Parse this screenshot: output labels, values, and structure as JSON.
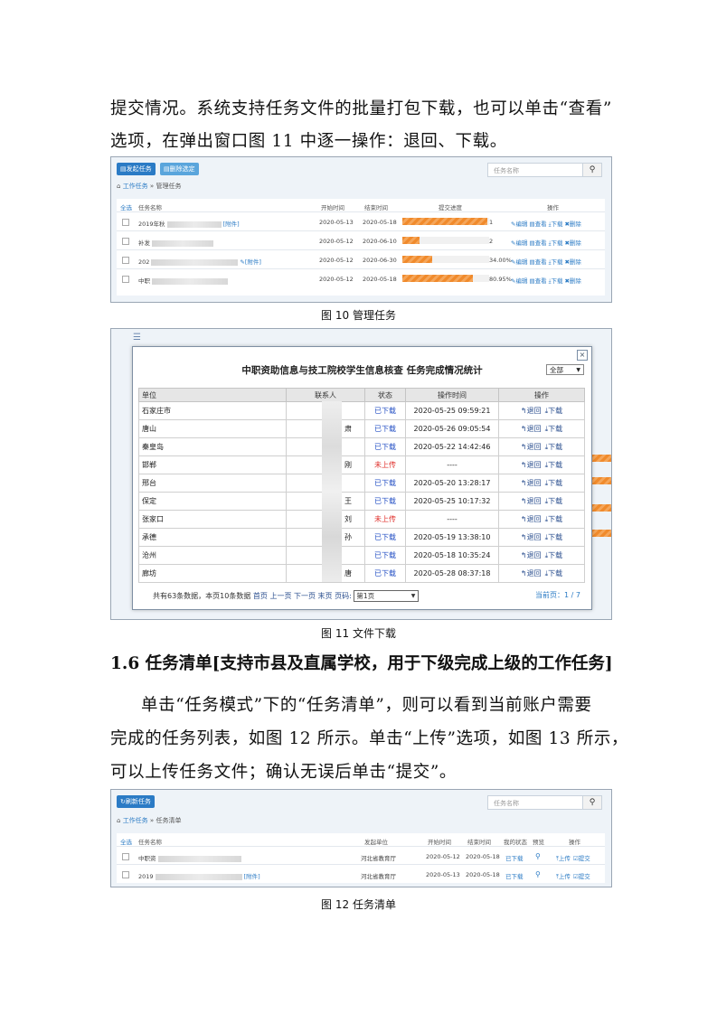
{
  "doc": {
    "para1_line1": "提交情况。系统支持任务文件的批量打包下载，也可以单击“查看”",
    "para1_line2": "选项，在弹出窗口图 11 中逐一操作：退回、下载。",
    "caption10": "图 10 管理任务",
    "caption11": "图 11 文件下载",
    "heading": "1.6 任务清单[支持市县及直属学校，用于下级完成上级的工作任务]",
    "para2_line1": "单击“任务模式”下的“任务清单”，则可以看到当前账户需要",
    "para2_line2": "完成的任务列表，如图 12 所示。单击“上传”选项，如图 13 所示，",
    "para2_line3": "可以上传任务文件；确认无误后单击“提交”。",
    "caption12": "图 12 任务清单"
  },
  "fig10": {
    "btn_new": "▤发起任务",
    "btn_delete": "▤删除选定",
    "search_placeholder": "任务名称",
    "search_icon": "search-icon",
    "crumb_home_icon": "home-icon",
    "crumb_link": "工作任务",
    "crumb_sep": "»",
    "crumb_current": "管理任务",
    "headers": {
      "select_all": "全选",
      "name": "任务名称",
      "start": "开始时间",
      "end": "结束时间",
      "progress": "提交进度",
      "ops": "操作"
    },
    "rows": [
      {
        "name": "2019年秋",
        "attach": "[附件]",
        "start": "2020-05-13",
        "end": "2020-05-18",
        "progress": 0.98,
        "pct": "1",
        "ops": [
          "✎编辑",
          "▤查看",
          "⤓下载",
          "✖删除"
        ]
      },
      {
        "name": "补发",
        "attach": "",
        "start": "2020-05-12",
        "end": "2020-06-10",
        "progress": 0.2,
        "pct": "2",
        "ops": [
          "✎编辑",
          "▤查看",
          "⤓下载",
          "✖删除"
        ]
      },
      {
        "name": "202",
        "attach": "✎[附件]",
        "start": "2020-05-12",
        "end": "2020-06-30",
        "progress": 0.34,
        "pct": "34.00%",
        "ops": [
          "✎编辑",
          "▤查看",
          "⤓下载",
          "✖删除"
        ]
      },
      {
        "name": "中职",
        "attach": "",
        "start": "2020-05-12",
        "end": "2020-05-18",
        "progress": 0.8095,
        "pct": "80.95%",
        "ops": [
          "✎编辑",
          "▤查看",
          "⤓下载",
          "✖删除"
        ]
      }
    ]
  },
  "fig11": {
    "menu_icon": "menu-icon",
    "title": "中职资助信息与技工院校学生信息核查 任务完成情况统计",
    "filter": "全部",
    "close": "×",
    "headers": {
      "unit": "单位",
      "contact": "联系人",
      "status": "状态",
      "time": "操作时间",
      "ops": "操作"
    },
    "rows": [
      {
        "unit": "石家庄市",
        "contact": "",
        "status": "已下载",
        "ok": true,
        "time": "2020-05-25 09:59:21"
      },
      {
        "unit": "唐山",
        "contact": "肃",
        "status": "已下载",
        "ok": true,
        "time": "2020-05-26 09:05:54"
      },
      {
        "unit": "秦皇岛",
        "contact": "",
        "status": "已下载",
        "ok": true,
        "time": "2020-05-22 14:42:46"
      },
      {
        "unit": "邯郸",
        "contact": "刚",
        "status": "未上传",
        "ok": false,
        "time": "----"
      },
      {
        "unit": "邢台",
        "contact": "",
        "status": "已下载",
        "ok": true,
        "time": "2020-05-20 13:28:17"
      },
      {
        "unit": "保定",
        "contact": "王",
        "status": "已下载",
        "ok": true,
        "time": "2020-05-25 10:17:32"
      },
      {
        "unit": "张家口",
        "contact": "刘",
        "status": "未上传",
        "ok": false,
        "time": "----"
      },
      {
        "unit": "承德",
        "contact": "孙",
        "status": "已下载",
        "ok": true,
        "time": "2020-05-19 13:38:10"
      },
      {
        "unit": "沧州",
        "contact": "",
        "status": "已下载",
        "ok": true,
        "time": "2020-05-18 10:35:24"
      },
      {
        "unit": "廊坊",
        "contact": "唐",
        "status": "已下载",
        "ok": true,
        "time": "2020-05-28 08:37:18"
      }
    ],
    "op_return": "↰退回",
    "op_download": "⤓下载",
    "pager_text": "共有63条数据，本页10条数据",
    "pager_links": [
      "首页",
      "上一页",
      "下一页",
      "末页",
      "页码:"
    ],
    "pager_select": "第1页",
    "pager_current": "当前页：1 / 7"
  },
  "fig12": {
    "btn_refresh": "↻刷新任务",
    "search_placeholder": "任务名称",
    "search_icon": "search-icon",
    "crumb_link": "工作任务",
    "crumb_sep": "»",
    "crumb_current": "任务清单",
    "headers": {
      "select_all": "全选",
      "name": "任务名称",
      "unit": "发起单位",
      "start": "开始时间",
      "end": "结束时间",
      "status": "我的状态",
      "preview": "预览",
      "ops": "操作"
    },
    "rows": [
      {
        "name": "中职资",
        "attach": "",
        "unit": "河北省教育厅",
        "start": "2020-05-12",
        "end": "2020-05-18",
        "status": "已下载",
        "ops": [
          "⤒上传",
          "☑提交"
        ]
      },
      {
        "name": "2019",
        "attach": "[附件]",
        "unit": "河北省教育厅",
        "start": "2020-05-13",
        "end": "2020-05-18",
        "status": "已下载",
        "ops": [
          "⤒上传",
          "☑提交"
        ]
      }
    ]
  }
}
